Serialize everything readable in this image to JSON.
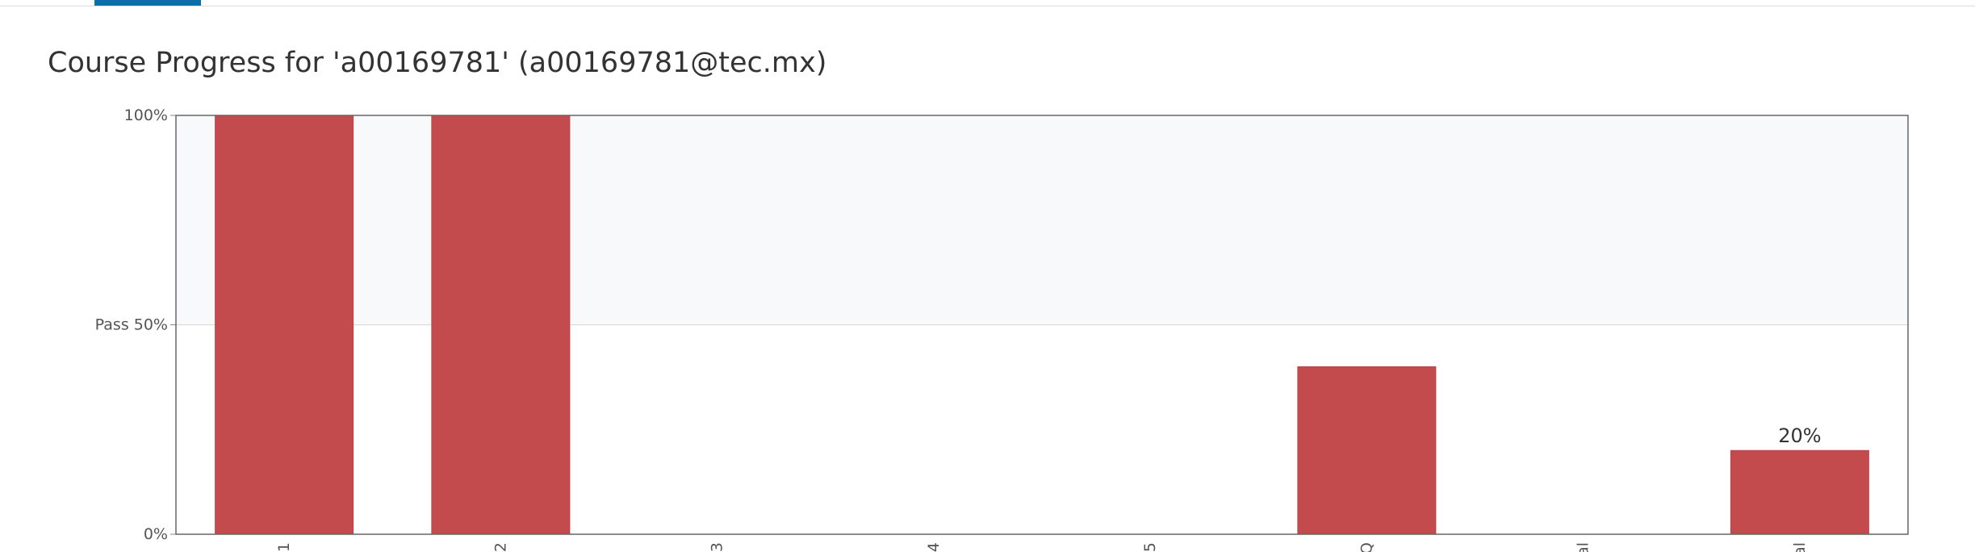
{
  "page": {
    "title": "Course Progress for 'a00169781' (a00169781@tec.mx)"
  },
  "colors": {
    "bar": "#c44b4d",
    "pass_region": "#f8f9fb",
    "active_tab": "#0e6fa8"
  },
  "chart_data": {
    "type": "bar",
    "categories": [
      "1",
      "2",
      "3",
      "4",
      "5",
      "Q",
      "al",
      "al"
    ],
    "values": [
      100,
      100,
      0,
      0,
      0,
      40,
      0,
      20
    ],
    "data_labels": {
      "7": "20%"
    },
    "ylim": [
      0,
      100
    ],
    "yticks": [
      {
        "value": 0,
        "label": "0%"
      },
      {
        "value": 50,
        "label": "Pass 50%"
      },
      {
        "value": 100,
        "label": "100%"
      }
    ],
    "pass_threshold": 50,
    "grid": false,
    "title": "",
    "xlabel": "",
    "ylabel": ""
  }
}
